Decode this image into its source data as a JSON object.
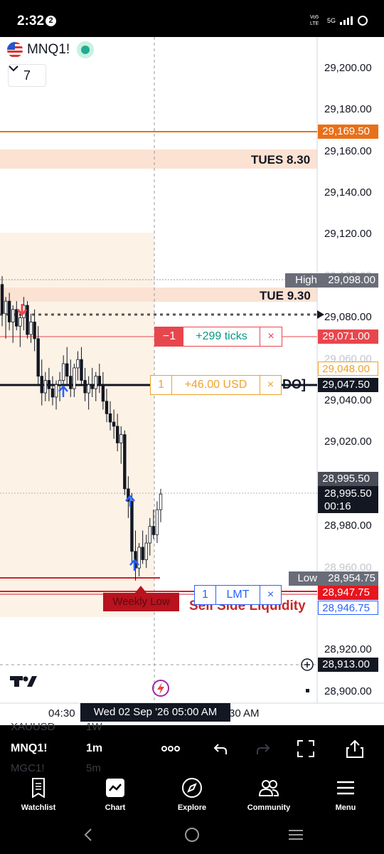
{
  "status_bar": {
    "time": "2:32",
    "notification_count": "2",
    "network": "Vo5 LTE",
    "signal": "5G"
  },
  "symbol": {
    "name": "MNQ1!",
    "collapse_count": "7"
  },
  "price_axis": {
    "labels": [
      "29,200.00",
      "29,180.00",
      "29,160.00",
      "29,140.00",
      "29,120.00",
      "29,080.00",
      "29,040.00",
      "29,020.00",
      "28,980.00",
      "28,920.00",
      "28,900.00"
    ],
    "hidden_labels": [
      "29,100.00",
      "29,060.00",
      "28,960.00"
    ]
  },
  "zones": [
    {
      "label": "TUES 8.30"
    },
    {
      "label": "TUE 9.30"
    }
  ],
  "levels": {
    "orange": "29,169.50",
    "high_label": "High",
    "high_value": "29,098.00",
    "short_order": "29,071.00",
    "pnl_price": "29,048.00",
    "black_line": "29,047.50",
    "black_line_text": "DO]",
    "last_price": "28,995.50",
    "current_price": "28,995.50",
    "countdown": "00:16",
    "low_label": "Low",
    "low_value": "28,954.75",
    "weekly_low_price": "28,947.75",
    "weekly_low_label": "Weekly Low",
    "limit_price": "28,946.75",
    "liquidity_label": "Sell Side Liquidity",
    "crosshair_price": "28,913.00"
  },
  "orders": {
    "short": {
      "qty": "−1",
      "info": "+299 ticks",
      "close": "×"
    },
    "position": {
      "qty": "1",
      "info": "+46.00 USD",
      "close": "×"
    },
    "limit": {
      "qty": "1",
      "info": "LMT",
      "close": "×"
    }
  },
  "time_axis": {
    "left": "04:30",
    "crosshair": "Wed 02 Sep '26   05:00 AM",
    "right": "30 AM"
  },
  "toolbar": {
    "symbol": "MNQ1!",
    "interval": "1m",
    "ghost_symbols": [
      "XAUUSD",
      "MGC1!"
    ],
    "ghost_intervals": [
      "1W",
      "5m"
    ]
  },
  "nav": [
    {
      "label": "Watchlist",
      "icon": "watchlist-icon"
    },
    {
      "label": "Chart",
      "icon": "chart-icon"
    },
    {
      "label": "Explore",
      "icon": "compass-icon"
    },
    {
      "label": "Community",
      "icon": "community-icon"
    },
    {
      "label": "Menu",
      "icon": "menu-icon"
    }
  ],
  "chart_data": {
    "type": "candlestick",
    "ylim": [
      28895,
      29210
    ],
    "candles": [
      [
        29096,
        29100,
        29076,
        29082
      ],
      [
        29082,
        29090,
        29070,
        29088
      ],
      [
        29088,
        29092,
        29074,
        29078
      ],
      [
        29078,
        29086,
        29068,
        29084
      ],
      [
        29084,
        29088,
        29074,
        29076
      ],
      [
        29076,
        29082,
        29066,
        29080
      ],
      [
        29080,
        29090,
        29074,
        29086
      ],
      [
        29086,
        29088,
        29070,
        29072
      ],
      [
        29072,
        29082,
        29068,
        29078
      ],
      [
        29078,
        29084,
        29064,
        29070
      ],
      [
        29070,
        29076,
        29048,
        29052
      ],
      [
        29052,
        29060,
        29038,
        29044
      ],
      [
        29044,
        29054,
        29040,
        29050
      ],
      [
        29050,
        29056,
        29040,
        29046
      ],
      [
        29046,
        29052,
        29038,
        29042
      ],
      [
        29042,
        29050,
        29036,
        29048
      ],
      [
        29048,
        29054,
        29040,
        29050
      ],
      [
        29050,
        29062,
        29046,
        29058
      ],
      [
        29058,
        29066,
        29048,
        29052
      ],
      [
        29052,
        29060,
        29042,
        29046
      ],
      [
        29046,
        29058,
        29042,
        29056
      ],
      [
        29056,
        29064,
        29050,
        29060
      ],
      [
        29060,
        29066,
        29048,
        29050
      ],
      [
        29050,
        29056,
        29040,
        29044
      ],
      [
        29044,
        29052,
        29036,
        29048
      ],
      [
        29048,
        29056,
        29042,
        29046
      ],
      [
        29046,
        29054,
        29040,
        29052
      ],
      [
        29052,
        29058,
        29044,
        29048
      ],
      [
        29048,
        29054,
        29036,
        29040
      ],
      [
        29040,
        29046,
        29030,
        29034
      ],
      [
        29034,
        29040,
        29026,
        29030
      ],
      [
        29030,
        29036,
        29022,
        29028
      ],
      [
        29028,
        29034,
        29016,
        29020
      ],
      [
        29020,
        29028,
        29010,
        29024
      ],
      [
        29024,
        29026,
        28995,
        28998
      ],
      [
        28998,
        29004,
        28984,
        28992
      ],
      [
        28992,
        28996,
        28962,
        28968
      ],
      [
        28968,
        28978,
        28954,
        28960
      ],
      [
        28960,
        28972,
        28956,
        28970
      ],
      [
        28970,
        28978,
        28962,
        28964
      ],
      [
        28964,
        28976,
        28960,
        28972
      ],
      [
        28972,
        28984,
        28966,
        28980
      ],
      [
        28980,
        28988,
        28974,
        28976
      ],
      [
        28976,
        28992,
        28972,
        28988
      ],
      [
        28988,
        28998,
        28982,
        28995.5
      ]
    ]
  }
}
